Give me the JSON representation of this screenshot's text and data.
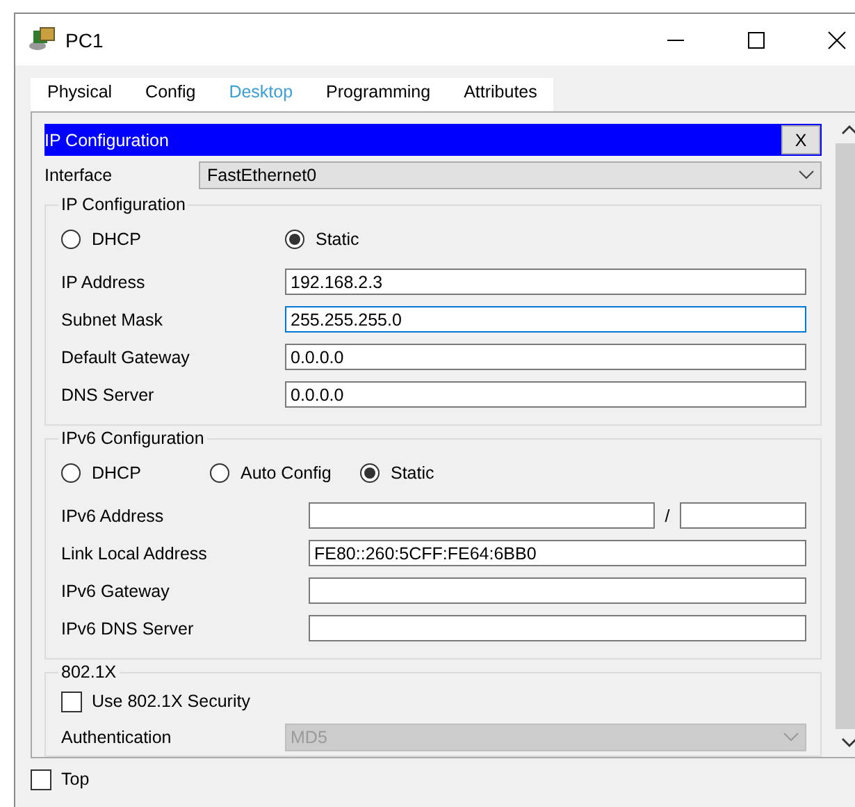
{
  "window": {
    "title": "PC1"
  },
  "tabs": [
    {
      "label": "Physical",
      "selected": false
    },
    {
      "label": "Config",
      "selected": false
    },
    {
      "label": "Desktop",
      "selected": true
    },
    {
      "label": "Programming",
      "selected": false
    },
    {
      "label": "Attributes",
      "selected": false
    }
  ],
  "dialog": {
    "title": "IP Configuration",
    "close_label": "X"
  },
  "interface": {
    "label": "Interface",
    "value": "FastEthernet0"
  },
  "ip_config": {
    "legend": "IP Configuration",
    "modes": [
      {
        "label": "DHCP",
        "selected": false
      },
      {
        "label": "Static",
        "selected": true
      }
    ],
    "fields": [
      {
        "label": "IP Address",
        "value": "192.168.2.3",
        "focused": false
      },
      {
        "label": "Subnet Mask",
        "value": "255.255.255.0",
        "focused": true
      },
      {
        "label": "Default Gateway",
        "value": "0.0.0.0",
        "focused": false
      },
      {
        "label": "DNS Server",
        "value": "0.0.0.0",
        "focused": false
      }
    ]
  },
  "ipv6_config": {
    "legend": "IPv6 Configuration",
    "modes": [
      {
        "label": "DHCP",
        "selected": false
      },
      {
        "label": "Auto Config",
        "selected": false
      },
      {
        "label": "Static",
        "selected": true
      }
    ],
    "fields": [
      {
        "kind": "prefix",
        "label": "IPv6 Address",
        "separator": "/"
      },
      {
        "kind": "text",
        "label": "Link Local Address",
        "value": "FE80::260:5CFF:FE64:6BB0"
      },
      {
        "kind": "text",
        "label": "IPv6 Gateway"
      },
      {
        "kind": "text",
        "label": "IPv6 DNS Server"
      }
    ]
  },
  "dot1x": {
    "legend": "802.1X",
    "checkbox": {
      "label": "Use 802.1X Security",
      "checked": false
    },
    "fields": [
      {
        "label": "Authentication",
        "value": "MD5",
        "disabled": true
      }
    ]
  },
  "footer": {
    "checkbox": {
      "label": "Top",
      "checked": false
    }
  }
}
